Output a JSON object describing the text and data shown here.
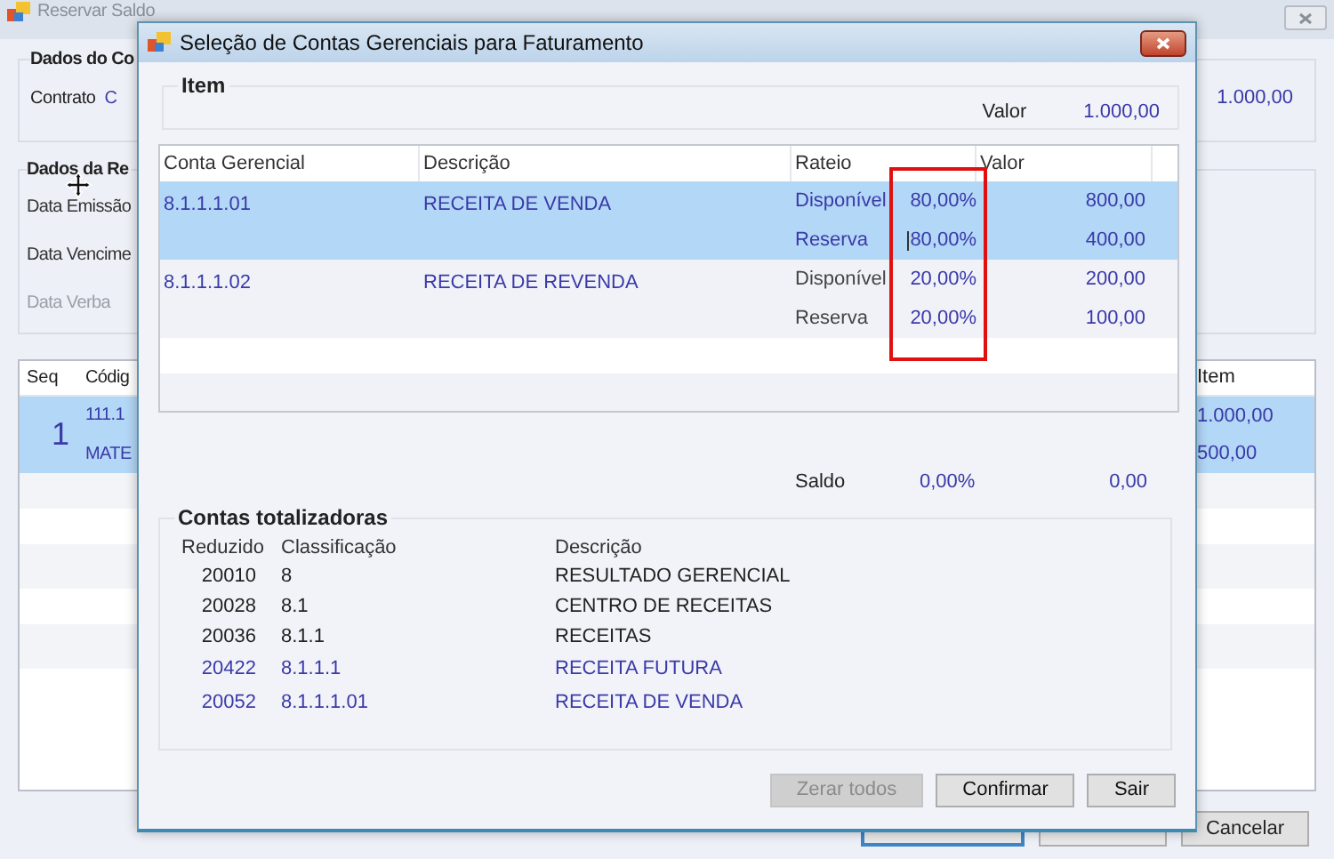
{
  "background_window": {
    "title": "Reservar Saldo",
    "contract_group": {
      "title": "Dados do Co",
      "label": "Contrato",
      "value": "C",
      "amount": "1.000,00"
    },
    "release_group": {
      "title": "Dados da Re",
      "fields": [
        {
          "label": "Data Emissão",
          "disabled": false
        },
        {
          "label": "Data Vencime",
          "disabled": false
        },
        {
          "label": "Data Verba",
          "disabled": true
        }
      ]
    },
    "grid": {
      "columns": [
        "Seq",
        "Códig",
        "Item"
      ],
      "rows": [
        {
          "seq": "1",
          "selected": true,
          "lines": [
            {
              "code": "111.1",
              "item": "1.000,00"
            },
            {
              "code": "MATE",
              "item": "500,00"
            }
          ]
        }
      ]
    },
    "buttons": [
      {
        "label": "Cancelar"
      }
    ]
  },
  "dialog": {
    "title": "Seleção de Contas Gerenciais para Faturamento",
    "item_group": {
      "title": "Item",
      "label": "Valor",
      "value": "1.000,00"
    },
    "accounts_table": {
      "columns": [
        "Conta Gerencial",
        "Descrição",
        "Rateio",
        "Valor"
      ],
      "rows": [
        {
          "account": "8.1.1.1.01",
          "description": "RECEITA DE VENDA",
          "selected": true,
          "splits": [
            {
              "label": "Disponível",
              "percent": "80,00%",
              "value": "800,00",
              "editing": false
            },
            {
              "label": "Reserva",
              "percent": "80,00%",
              "value": "400,00",
              "editing": true
            }
          ]
        },
        {
          "account": "8.1.1.1.02",
          "description": "RECEITA DE REVENDA",
          "selected": false,
          "splits": [
            {
              "label": "Disponível",
              "percent": "20,00%",
              "value": "200,00",
              "editing": false
            },
            {
              "label": "Reserva",
              "percent": "20,00%",
              "value": "100,00",
              "editing": false
            }
          ]
        }
      ]
    },
    "saldo": {
      "label": "Saldo",
      "percent": "0,00%",
      "value": "0,00"
    },
    "totals_group": {
      "title": "Contas totalizadoras",
      "columns": [
        "Reduzido",
        "Classificação",
        "Descrição"
      ],
      "rows": [
        {
          "code": "20010",
          "classification": "8",
          "description": "RESULTADO GERENCIAL",
          "highlighted": false
        },
        {
          "code": "20028",
          "classification": "8.1",
          "description": "CENTRO DE RECEITAS",
          "highlighted": false
        },
        {
          "code": "20036",
          "classification": "8.1.1",
          "description": "RECEITAS",
          "highlighted": false
        },
        {
          "code": "20422",
          "classification": "8.1.1.1",
          "description": "RECEITA FUTURA",
          "highlighted": true
        },
        {
          "code": "20052",
          "classification": "8.1.1.1.01",
          "description": "RECEITA DE VENDA",
          "highlighted": true
        }
      ]
    },
    "buttons": [
      {
        "label": "Zerar todos",
        "disabled": true
      },
      {
        "label": "Confirmar",
        "disabled": false
      },
      {
        "label": "Sair",
        "disabled": false
      }
    ]
  }
}
